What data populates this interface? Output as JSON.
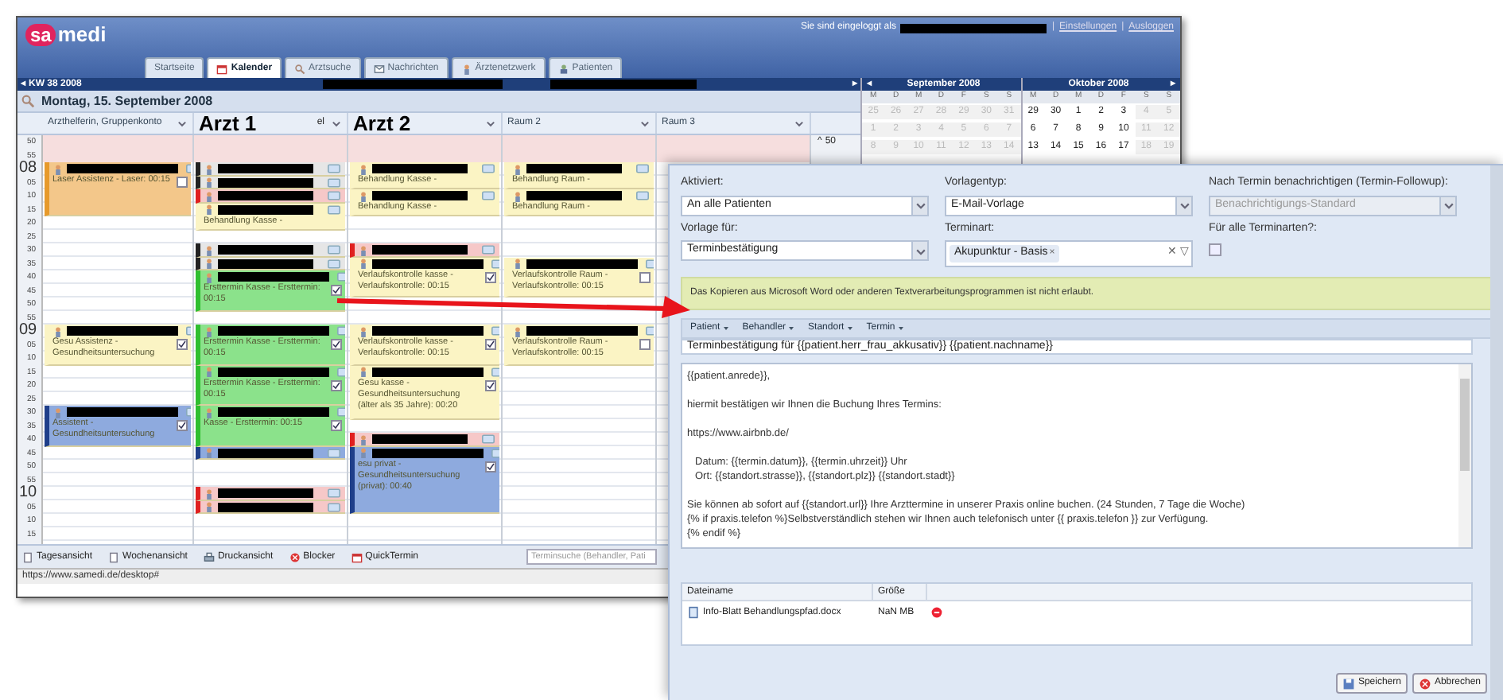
{
  "header": {
    "logo": [
      "sa",
      "medi"
    ],
    "login": {
      "text": "Sie sind eingeloggt als",
      "links": [
        {
          "separator": "|",
          "label": "Einstellungen"
        },
        {
          "separator": "|",
          "label": "Ausloggen"
        }
      ]
    },
    "tabs": [
      {
        "label": "Startseite",
        "selected": false
      },
      {
        "label": "Kalender",
        "selected": true
      },
      {
        "label": "Arztsuche",
        "selected": false
      },
      {
        "label": "Nachrichten",
        "selected": false
      },
      {
        "label": "Ärztenetzwerk",
        "selected": false
      },
      {
        "label": "Patienten",
        "selected": false
      }
    ]
  },
  "week_bar": {
    "label": "KW 38 2008",
    "prev": "◂",
    "next": "▸"
  },
  "date": "Montag, 15. September 2008",
  "columns": [
    {
      "label": "Arzthelferin, Gruppenkonto",
      "kind": "staff",
      "appointments": [
        {
          "kind": "orange",
          "text": "Laser Assistenz - Laser: 00:15",
          "checked": false
        },
        {
          "kind": "yellow",
          "text": "Gesu Assistenz - Gesundheitsuntersuchung",
          "checked": true
        },
        {
          "kind": "blue",
          "text": "Assistent - Gesundheitsuntersuchung",
          "checked": true
        }
      ]
    },
    {
      "label": "Arzt 1",
      "title_fragment": "el",
      "kind": "doctor",
      "appointments": [
        {
          "kind": "gray"
        },
        {
          "kind": "gray"
        },
        {
          "kind": "pink"
        },
        {
          "kind": "yellow",
          "text": "Behandlung Kasse -"
        },
        {
          "kind": "gray"
        },
        {
          "kind": "gray"
        },
        {
          "kind": "green",
          "text": "Ersttermin Kasse - Ersttermin: 00:15",
          "checked": true
        },
        {
          "kind": "green",
          "text": "Ersttermin Kasse - Ersttermin: 00:15",
          "checked": true
        },
        {
          "kind": "green",
          "text": "Ersttermin Kasse - Ersttermin: 00:15",
          "checked": true
        },
        {
          "kind": "green",
          "text": "Kasse - Ersttermin: 00:15",
          "checked": true
        },
        {
          "kind": "blue"
        },
        {
          "kind": "pink"
        },
        {
          "kind": "pink"
        }
      ]
    },
    {
      "label": "Arzt 2",
      "kind": "doctor",
      "appointments": [
        {
          "kind": "yellow",
          "text": "Behandlung Kasse -"
        },
        {
          "kind": "yellow",
          "text": "Behandlung Kasse -"
        },
        {
          "kind": "pink"
        },
        {
          "kind": "yellow",
          "text": "Verlaufskontrolle kasse - Verlaufskontrolle: 00:15",
          "checked": true
        },
        {
          "kind": "yellow",
          "text": "Verlaufskontrolle kasse - Verlaufskontrolle: 00:15",
          "checked": true
        },
        {
          "kind": "yellow",
          "text": "Gesu kasse - Gesundheitsuntersuchung (älter als 35 Jahre): 00:20",
          "checked": true
        },
        {
          "kind": "pink"
        },
        {
          "kind": "blue",
          "text": "esu privat - Gesundheitsuntersuchung (privat): 00:40",
          "checked": true
        }
      ]
    },
    {
      "label": "Raum 2",
      "kind": "room",
      "appointments": [
        {
          "kind": "yellow",
          "text": "Behandlung Raum -"
        },
        {
          "kind": "yellow",
          "text": "Behandlung Raum -"
        },
        {
          "kind": "yellow",
          "text": "Verlaufskontrolle Raum - Verlaufskontrolle: 00:15",
          "checked": false
        },
        {
          "kind": "yellow",
          "text": "Verlaufskontrolle Raum - Verlaufskontrolle: 00:15",
          "checked": false
        }
      ]
    },
    {
      "label": "Raum 3",
      "kind": "room"
    }
  ],
  "times": [
    {
      "label": "50",
      "kind": "minute"
    },
    {
      "label": "55",
      "kind": "minute"
    },
    {
      "label": "08",
      "kind": "hour"
    },
    {
      "label": "05",
      "kind": "minute"
    },
    {
      "label": "10",
      "kind": "minute"
    },
    {
      "label": "15",
      "kind": "minute"
    },
    {
      "label": "20",
      "kind": "minute"
    },
    {
      "label": "25",
      "kind": "minute"
    },
    {
      "label": "30",
      "kind": "minute"
    },
    {
      "label": "35",
      "kind": "minute"
    },
    {
      "label": "40",
      "kind": "minute"
    },
    {
      "label": "45",
      "kind": "minute"
    },
    {
      "label": "50",
      "kind": "minute"
    },
    {
      "label": "55",
      "kind": "minute"
    },
    {
      "label": "09",
      "kind": "hour"
    },
    {
      "label": "05",
      "kind": "minute"
    },
    {
      "label": "10",
      "kind": "minute"
    },
    {
      "label": "15",
      "kind": "minute"
    },
    {
      "label": "20",
      "kind": "minute"
    },
    {
      "label": "25",
      "kind": "minute"
    },
    {
      "label": "30",
      "kind": "minute"
    },
    {
      "label": "35",
      "kind": "minute"
    },
    {
      "label": "40",
      "kind": "minute"
    },
    {
      "label": "45",
      "kind": "minute"
    },
    {
      "label": "50",
      "kind": "minute"
    },
    {
      "label": "55",
      "kind": "minute"
    },
    {
      "label": "10",
      "kind": "hour"
    },
    {
      "label": "05",
      "kind": "minute"
    },
    {
      "label": "10",
      "kind": "minute"
    },
    {
      "label": "15",
      "kind": "minute"
    }
  ],
  "right_gutter": {
    "arrow": "^",
    "time": "50"
  },
  "toolbar": {
    "buttons": [
      "Tagesansicht",
      "Wochenansicht",
      "Druckansicht",
      "Blocker",
      "QuickTermin"
    ],
    "search_placeholder": "Terminsuche (Behandler, Pati"
  },
  "status_bar": "https://www.samedi.de/desktop#",
  "mini_calendars": [
    {
      "title": "September 2008",
      "nav": "◂",
      "weekdays": [
        "M",
        "D",
        "M",
        "D",
        "F",
        "S",
        "S"
      ],
      "weeks": [
        [
          {
            "day": "25",
            "muted": true
          },
          {
            "day": "26",
            "muted": true
          },
          {
            "day": "27",
            "muted": true
          },
          {
            "day": "28",
            "muted": true
          },
          {
            "day": "29",
            "muted": true
          },
          {
            "day": "30",
            "muted": true
          },
          {
            "day": "31",
            "muted": true
          }
        ],
        [
          {
            "day": "1",
            "muted": true
          },
          {
            "day": "2",
            "muted": true
          },
          {
            "day": "3",
            "muted": true
          },
          {
            "day": "4",
            "muted": true
          },
          {
            "day": "5",
            "muted": true
          },
          {
            "day": "6",
            "muted": true
          },
          {
            "day": "7",
            "muted": true
          }
        ],
        [
          {
            "day": "8",
            "muted": true
          },
          {
            "day": "9",
            "muted": true
          },
          {
            "day": "10",
            "muted": true
          },
          {
            "day": "11",
            "muted": true
          },
          {
            "day": "12",
            "muted": true
          },
          {
            "day": "13",
            "muted": true
          },
          {
            "day": "14",
            "muted": true
          }
        ]
      ]
    },
    {
      "title": "Oktober 2008",
      "nav": "▸",
      "weekdays": [
        "M",
        "D",
        "M",
        "D",
        "F",
        "S",
        "S"
      ],
      "weeks": [
        [
          {
            "day": "29",
            "muted": false
          },
          {
            "day": "30",
            "muted": false
          },
          {
            "day": "1",
            "muted": false
          },
          {
            "day": "2",
            "muted": false
          },
          {
            "day": "3",
            "muted": false
          },
          {
            "day": "4",
            "muted": true
          },
          {
            "day": "5",
            "muted": true
          }
        ],
        [
          {
            "day": "6",
            "muted": false
          },
          {
            "day": "7",
            "muted": false
          },
          {
            "day": "8",
            "muted": false
          },
          {
            "day": "9",
            "muted": false
          },
          {
            "day": "10",
            "muted": false
          },
          {
            "day": "11",
            "muted": true
          },
          {
            "day": "12",
            "muted": true
          }
        ],
        [
          {
            "day": "13",
            "muted": false
          },
          {
            "day": "14",
            "muted": false
          },
          {
            "day": "15",
            "muted": false
          },
          {
            "day": "16",
            "muted": false
          },
          {
            "day": "17",
            "muted": false
          },
          {
            "day": "18",
            "muted": true
          },
          {
            "day": "19",
            "muted": true
          }
        ]
      ]
    }
  ],
  "dialog": {
    "fields": [
      {
        "label": "Aktiviert:",
        "kind": "select",
        "value": "An alle Patienten",
        "disabled": false
      },
      {
        "label": "Vorlagentyp:",
        "kind": "select",
        "value": "E-Mail-Vorlage",
        "disabled": false
      },
      {
        "label": "Nach Termin benachrichtigen (Termin-Followup):",
        "kind": "select",
        "value": "Benachrichtigungs-Standard",
        "disabled": true
      },
      {
        "label": "Vorlage für:",
        "kind": "select",
        "value": "Terminbestätigung",
        "disabled": false
      },
      {
        "label": "Terminart:",
        "kind": "tags",
        "tags": [
          "Akupunktur - Basis"
        ],
        "tag_remove": "×",
        "clear": "✕",
        "toggle": "▽"
      },
      {
        "label": "Für alle Terminarten?:",
        "kind": "checkbox",
        "checked": false
      }
    ],
    "notice": "Das Kopieren aus Microsoft Word oder anderen Textverarbeitungsprogrammen ist nicht erlaubt.",
    "insert_menus": [
      "Patient",
      "Behandler",
      "Standort",
      "Termin"
    ],
    "subject": "Terminbestätigung für {{patient.herr_frau_akkusativ}} {{patient.nachname}}",
    "body": [
      {
        "indented": false,
        "lines": [
          "{{patient.anrede}},"
        ]
      },
      {
        "indented": false,
        "lines": [
          "hiermit bestätigen wir Ihnen die Buchung Ihres Termins:"
        ]
      },
      {
        "indented": false,
        "lines": [
          "https://www.airbnb.de/"
        ]
      },
      {
        "indented": true,
        "lines": [
          "Datum: {{termin.datum}}, {{termin.uhrzeit}} Uhr",
          "Ort: {{standort.strasse}}, {{standort.plz}} {{standort.stadt}}"
        ]
      },
      {
        "indented": false,
        "lines": [
          "Sie können ab sofort auf {{standort.url}} Ihre Arzttermine in unserer Praxis online buchen. (24 Stunden, 7 Tage die Woche)",
          "{% if praxis.telefon %}Selbstverständlich stehen wir Ihnen auch telefonisch unter {{ praxis.telefon }} zur Verfügung.",
          "{% endif %}"
        ]
      }
    ],
    "files": {
      "columns": [
        "Dateiname",
        "Größe"
      ],
      "rows": [
        {
          "name": "Info-Blatt Behandlungspfad.docx",
          "size": "NaN MB"
        }
      ]
    },
    "buttons": [
      {
        "label": "Speichern",
        "kind": "save"
      },
      {
        "label": "Abbrechen",
        "kind": "cancel"
      }
    ]
  }
}
